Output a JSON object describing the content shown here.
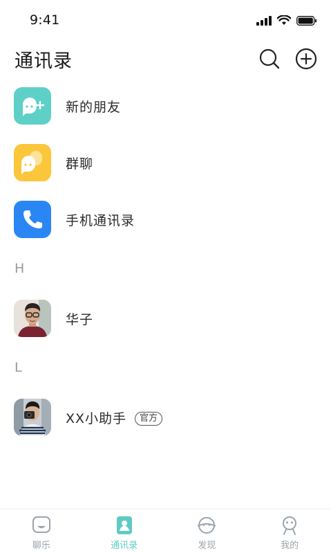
{
  "status_bar": {
    "time": "9:41"
  },
  "header": {
    "title": "通讯录"
  },
  "shortcuts": [
    {
      "label": "新的朋友",
      "icon": "new-friend-icon",
      "color": "#5ed0c8"
    },
    {
      "label": "群聊",
      "icon": "group-chat-icon",
      "color": "#fbc63a"
    },
    {
      "label": "手机通讯录",
      "icon": "phone-icon",
      "color": "#2a86f3"
    }
  ],
  "sections": [
    {
      "letter": "H",
      "contacts": [
        {
          "name": "华子"
        }
      ]
    },
    {
      "letter": "L",
      "contacts": [
        {
          "name": "XX小助手",
          "badge": "官方"
        }
      ]
    }
  ],
  "tabbar": {
    "tabs": [
      {
        "label": "聊乐",
        "icon": "chat-icon"
      },
      {
        "label": "通讯录",
        "icon": "contacts-icon",
        "active": true
      },
      {
        "label": "发现",
        "icon": "discover-icon"
      },
      {
        "label": "我的",
        "icon": "profile-icon"
      }
    ]
  },
  "colors": {
    "accent": "#5ecbc4",
    "inactive": "#9aa4ad"
  }
}
